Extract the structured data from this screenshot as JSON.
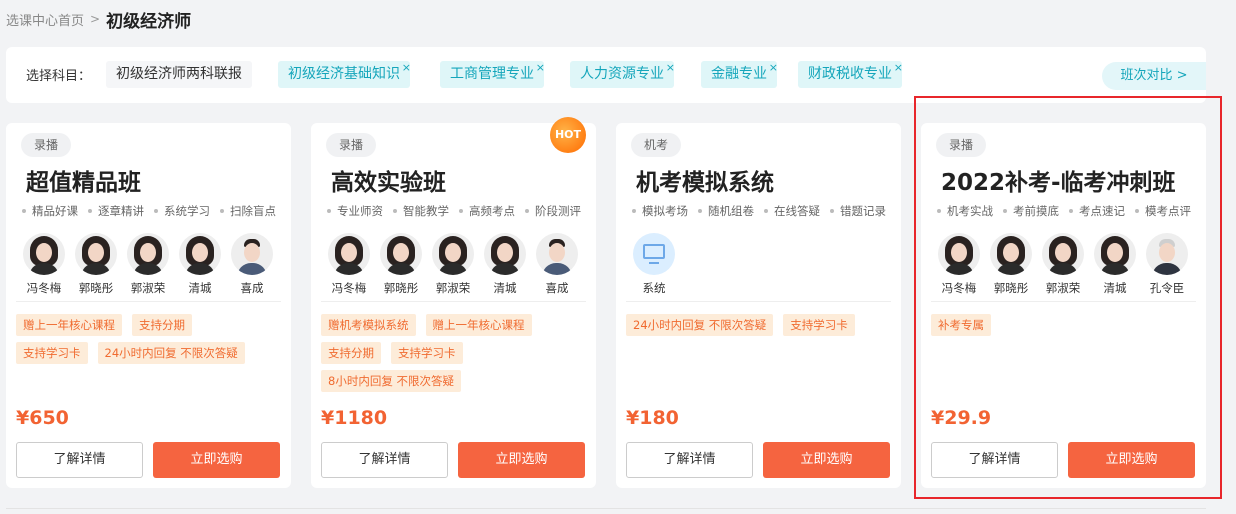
{
  "breadcrumb": {
    "home": "选课中心首页",
    "sep": ">",
    "current": "初级经济师"
  },
  "filter": {
    "label": "选择科目：",
    "main_chip": "初级经济师两科联报",
    "chips": [
      "初级经济基础知识",
      "工商管理专业",
      "人力资源专业",
      "金融专业",
      "财政税收专业"
    ],
    "chip_close": "×",
    "compare": "班次对比 >"
  },
  "cards": [
    {
      "type": "录播",
      "title": "超值精品班",
      "features": [
        "精品好课",
        "逐章精讲",
        "系统学习",
        "扫除盲点"
      ],
      "teachers": [
        "冯冬梅",
        "郭晓彤",
        "郭淑荣",
        "清城",
        "喜成"
      ],
      "tags": [
        "赠上一年核心课程",
        "支持分期",
        "支持学习卡",
        "24小时内回复 不限次答疑"
      ],
      "price": "¥650",
      "detail": "了解详情",
      "buy": "立即选购"
    },
    {
      "type": "录播",
      "hot": "HOT",
      "title": "高效实验班",
      "features": [
        "专业师资",
        "智能教学",
        "高频考点",
        "阶段测评"
      ],
      "teachers": [
        "冯冬梅",
        "郭晓彤",
        "郭淑荣",
        "清城",
        "喜成"
      ],
      "tags": [
        "赠机考模拟系统",
        "赠上一年核心课程",
        "支持分期",
        "支持学习卡",
        "8小时内回复 不限次答疑"
      ],
      "price": "¥1180",
      "detail": "了解详情",
      "buy": "立即选购"
    },
    {
      "type": "机考",
      "title": "机考模拟系统",
      "features": [
        "模拟考场",
        "随机组卷",
        "在线答疑",
        "错题记录"
      ],
      "teachers": [
        "系统"
      ],
      "tags": [
        "24小时内回复 不限次答疑",
        "支持学习卡"
      ],
      "price": "¥180",
      "detail": "了解详情",
      "buy": "立即选购"
    },
    {
      "type": "录播",
      "title": "2022补考-临考冲刺班",
      "features": [
        "机考实战",
        "考前摸底",
        "考点速记",
        "模考点评"
      ],
      "teachers": [
        "冯冬梅",
        "郭晓彤",
        "郭淑荣",
        "清城",
        "孔令臣"
      ],
      "tags": [
        "补考专属"
      ],
      "price": "¥29.9",
      "detail": "了解详情",
      "buy": "立即选购"
    }
  ],
  "colors": {
    "accent": "#f56440",
    "price": "#f26333",
    "chip_text": "#15a6bb",
    "highlight": "#e8262b"
  }
}
